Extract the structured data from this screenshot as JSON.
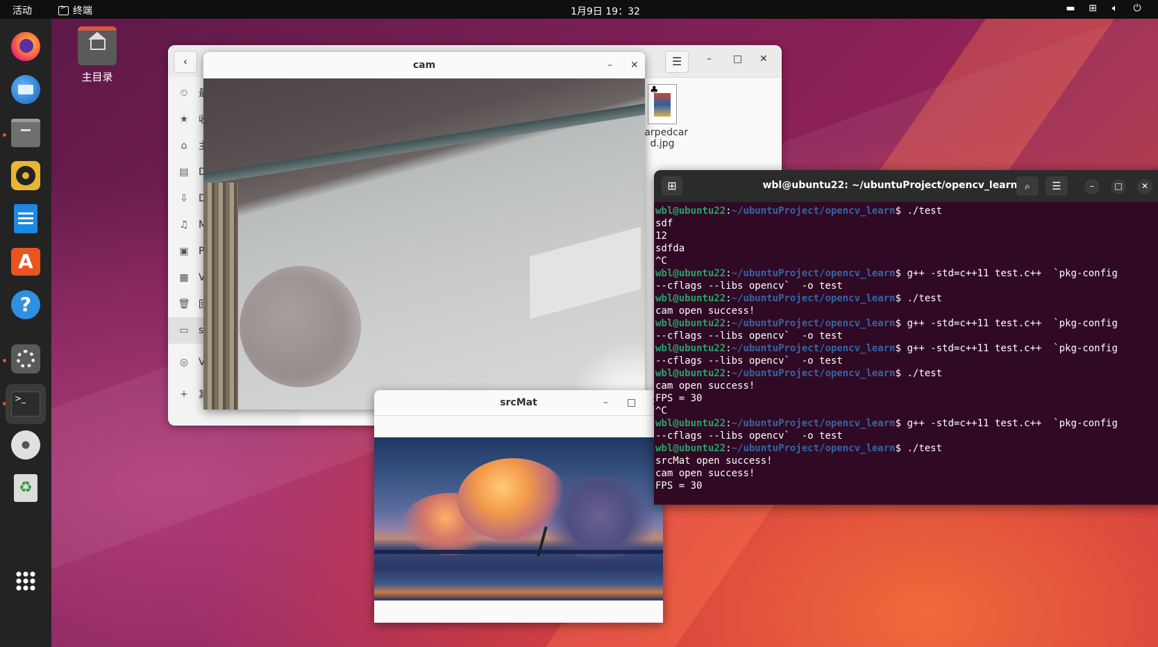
{
  "topbar": {
    "activities": "活动",
    "app_name": "终端",
    "clock": "1月9日 19：32"
  },
  "desktop": {
    "home_label": "主目录"
  },
  "dock": {
    "items": [
      "firefox",
      "thunderbird",
      "files",
      "rhythmbox",
      "libreoffice-writer",
      "app-center",
      "help",
      "settings",
      "terminal",
      "disc",
      "trash",
      "show-apps"
    ]
  },
  "files": {
    "sidebar": [
      {
        "icon": "clock-icon",
        "label": "最"
      },
      {
        "icon": "star-icon",
        "label": "收"
      },
      {
        "icon": "home-icon",
        "label": "主"
      },
      {
        "icon": "document-icon",
        "label": "Do"
      },
      {
        "icon": "download-icon",
        "label": "Do"
      },
      {
        "icon": "music-icon",
        "label": "Mu"
      },
      {
        "icon": "picture-icon",
        "label": "Pi"
      },
      {
        "icon": "video-icon",
        "label": "Vi"
      },
      {
        "icon": "trash-icon",
        "label": "回"
      },
      {
        "icon": "drive-icon",
        "label": "sh"
      },
      {
        "icon": "disc-icon",
        "label": "VB"
      },
      {
        "icon": "plus-icon",
        "label": "其"
      }
    ],
    "file": {
      "name_line1": "warpedcar",
      "name_line2": "d.jpg"
    }
  },
  "cam": {
    "title": "cam"
  },
  "srcmat": {
    "title": "srcMat"
  },
  "terminal": {
    "title": "wbl@ubuntu22: ~/ubuntuProject/opencv_learn",
    "user": "wbl@ubuntu22",
    "path": "~/ubuntuProject/opencv_learn",
    "lines": [
      {
        "type": "cmd",
        "text": "$ ./test"
      },
      {
        "type": "out",
        "text": "sdf"
      },
      {
        "type": "out",
        "text": "12"
      },
      {
        "type": "out",
        "text": "sdfda"
      },
      {
        "type": "out",
        "text": "^C"
      },
      {
        "type": "cmd",
        "text": "$ g++ -std=c++11 test.c++  `pkg-config"
      },
      {
        "type": "out",
        "text": "--cflags --libs opencv`  -o test"
      },
      {
        "type": "cmd",
        "text": "$ ./test"
      },
      {
        "type": "out",
        "text": "cam open success!"
      },
      {
        "type": "cmd",
        "text": "$ g++ -std=c++11 test.c++  `pkg-config"
      },
      {
        "type": "out",
        "text": "--cflags --libs opencv`  -o test"
      },
      {
        "type": "cmd",
        "text": "$ g++ -std=c++11 test.c++  `pkg-config"
      },
      {
        "type": "out",
        "text": "--cflags --libs opencv`  -o test"
      },
      {
        "type": "cmd",
        "text": "$ ./test"
      },
      {
        "type": "out",
        "text": "cam open success!"
      },
      {
        "type": "out",
        "text": "FPS = 30"
      },
      {
        "type": "out",
        "text": "^C"
      },
      {
        "type": "cmd",
        "text": "$ g++ -std=c++11 test.c++  `pkg-config"
      },
      {
        "type": "out",
        "text": "--cflags --libs opencv`  -o test"
      },
      {
        "type": "cmd",
        "text": "$ ./test"
      },
      {
        "type": "out",
        "text": "srcMat open success!"
      },
      {
        "type": "out",
        "text": "cam open success!"
      },
      {
        "type": "out",
        "text": "FPS = 30"
      }
    ]
  }
}
